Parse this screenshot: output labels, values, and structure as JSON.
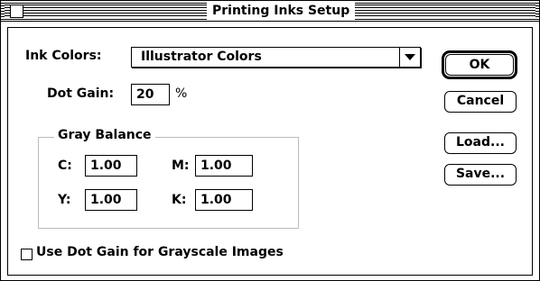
{
  "window": {
    "title": "Printing Inks Setup"
  },
  "ink_colors": {
    "label": "Ink Colors:",
    "selected": "Illustrator Colors"
  },
  "dot_gain": {
    "label": "Dot Gain:",
    "value": "20",
    "unit": "%"
  },
  "gray_balance": {
    "title": "Gray Balance",
    "c_label": "C:",
    "c_value": "1.00",
    "m_label": "M:",
    "m_value": "1.00",
    "y_label": "Y:",
    "y_value": "1.00",
    "k_label": "K:",
    "k_value": "1.00"
  },
  "use_dot_gain": {
    "label": "Use Dot Gain for Grayscale Images",
    "checked": false
  },
  "buttons": {
    "ok": "OK",
    "cancel": "Cancel",
    "load": "Load...",
    "save": "Save..."
  }
}
